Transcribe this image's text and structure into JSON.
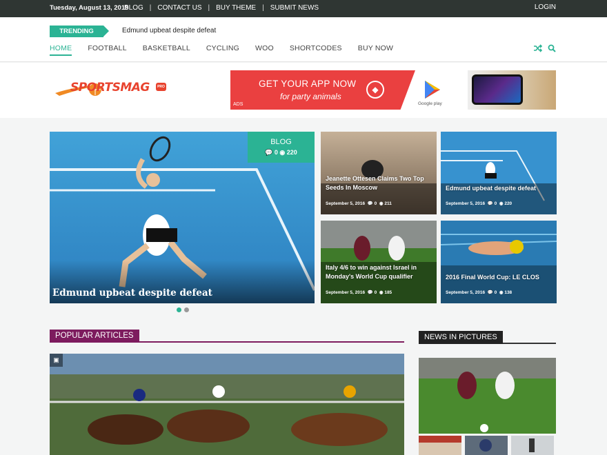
{
  "topbar": {
    "date": "Tuesday, August 13, 2019",
    "links": [
      "BLOG",
      "CONTACT US",
      "BUY THEME",
      "SUBMIT NEWS"
    ],
    "login": "LOGIN"
  },
  "trending": {
    "badge": "TRENDING",
    "headline": "Edmund upbeat despite defeat"
  },
  "menu": {
    "items": [
      "HOME",
      "FOOTBALL",
      "BASKETBALL",
      "CYCLING",
      "WOO",
      "SHORTCODES",
      "BUY NOW"
    ],
    "icons": [
      "shuffle-icon",
      "search-icon"
    ]
  },
  "logo": {
    "text": "SPORTSMAG",
    "badge": "PRO"
  },
  "ad": {
    "line1": "GET YOUR APP NOW",
    "line2": "for party animals",
    "label": "ADS",
    "store": "Google play"
  },
  "featured": {
    "category": "BLOG",
    "comments": "0",
    "views": "220",
    "title": "Edmund upbeat despite defeat"
  },
  "cards": [
    {
      "title": "Jeanette Ottesen Claims Two Top Seeds In Moscow",
      "date": "September 5, 2016",
      "comments": "0",
      "views": "211"
    },
    {
      "title": "Edmund upbeat despite defeat",
      "date": "September 5, 2016",
      "comments": "0",
      "views": "220"
    },
    {
      "title": "Italy 4/6 to win against Israel in Monday's World Cup qualifier",
      "date": "September 5, 2016",
      "comments": "0",
      "views": "185"
    },
    {
      "title": "2016 Final World Cup: LE CLOS",
      "date": "September 5, 2016",
      "comments": "0",
      "views": "138"
    }
  ],
  "sections": {
    "popular": "POPULAR ARTICLES",
    "pictures": "NEWS IN PICTURES"
  },
  "colors": {
    "accent": "#2bb394",
    "popular": "#7d1b5e",
    "topbar": "#2f3633"
  }
}
